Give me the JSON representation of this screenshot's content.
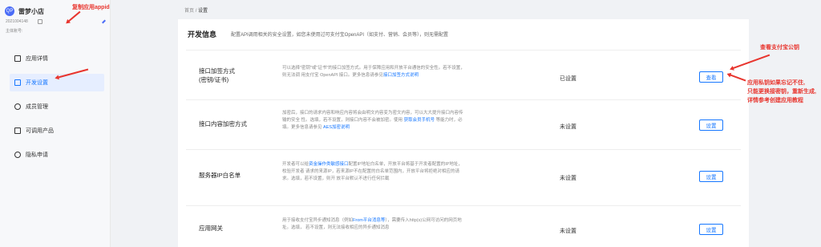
{
  "app": {
    "avatar_text": "QP",
    "name": "雷梦小店",
    "app_id": "2021004148",
    "account_label": "主体账号:"
  },
  "menu": [
    {
      "label": "应用详情",
      "icon": "detail-icon",
      "active": false
    },
    {
      "label": "开发设置",
      "icon": "dev-settings-icon",
      "active": true
    },
    {
      "label": "成员管理",
      "icon": "members-icon",
      "active": false
    },
    {
      "label": "可调用产品",
      "icon": "products-icon",
      "active": false
    },
    {
      "label": "隐私申请",
      "icon": "privacy-icon",
      "active": false
    }
  ],
  "annotations": {
    "copy_appid": "复制应用appid",
    "view_pubkey": "查看支付宝公钥",
    "reset_note_1": "应用私钥如果忘记不住,",
    "reset_note_2": "只能更换接密钥，重新生成,",
    "reset_note_3": "详情参考创建应用教程"
  },
  "breadcrumb": {
    "home": "首页",
    "sep": "/",
    "current": "设置"
  },
  "panel": {
    "title": "开发信息",
    "desc": "配置API调用相关的安全设置，如您未使用过可支付宝OpenAPI（如支付、营销、会员等），则无需配置"
  },
  "rows": [
    {
      "label_1": "接口加签方式",
      "label_2": "(密钥/证书)",
      "desc_1": "可以选择\"密钥\"或\"证书\"的接口加签方式。用于保障应用和开放平台通信的安全性。若不设置，则无法调",
      "desc_2": "用支付宝 OpenAPI 接口。更多信息请参见",
      "desc_link": "接口加签方式说明",
      "status": "已设置",
      "button": "查看"
    },
    {
      "label_1": "接口内容加密方式",
      "label_2": "",
      "desc_1": "加密后，接口的请求内容和响应内容将会由明文内容变为密文内容，可以大大提升接口内容传输的安全",
      "desc_2": "性。选填，若不设置，则接口内容不会被加密。使用",
      "desc_link": "获取会员手机号",
      "desc_3": "等能力时，必填。更多信息请参见",
      "desc_link2": "AES加密说明",
      "status": "未设置",
      "button": "设置"
    },
    {
      "label_1": "服务器IP白名单",
      "label_2": "",
      "desc_1": "开发者可以给",
      "desc_link": "资金操作类敏感接口",
      "desc_2": "配置IP地址白名单，开放平台将基于开发者配置的IP地址，校验开发者",
      "desc_3": "请求的来源IP，若来源IP不在配置的白名单范围内，开放平台将拒绝对相应的请求。选填，若不设置，则开",
      "desc_4": "放平台默认不进行任何拦截",
      "status": "未设置",
      "button": "设置"
    },
    {
      "label_1": "应用网关",
      "label_2": "",
      "desc_1": "用于接收支付宝异步通知消息（例如",
      "desc_link": "From平台消息等",
      "desc_2": "），需要传入http(s)公网可访问的网页地址。选填，",
      "desc_3": "若不设置，则无法接收相应的异步通知消息",
      "status": "未设置",
      "button": "设置"
    }
  ]
}
